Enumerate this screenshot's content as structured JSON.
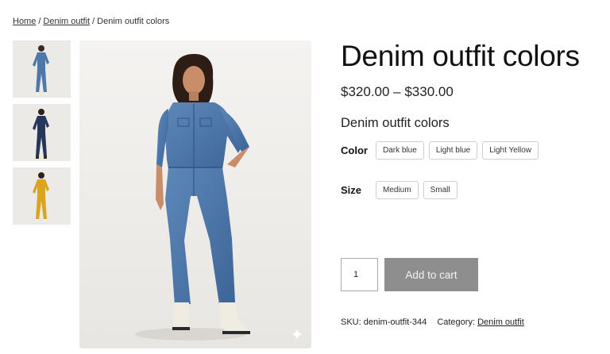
{
  "breadcrumb": {
    "home": "Home",
    "category": "Denim outfit",
    "current": "Denim outfit colors",
    "separator": "/"
  },
  "gallery": {
    "thumbnails": [
      {
        "name": "thumbnail-light-blue",
        "color": "#4f78a8"
      },
      {
        "name": "thumbnail-dark-blue",
        "color": "#25365a"
      },
      {
        "name": "thumbnail-light-yellow",
        "color": "#d9a520"
      }
    ],
    "main_color": "#4d79aa"
  },
  "product": {
    "title": "Denim outfit colors",
    "price": "$320.00 – $330.00",
    "subtitle": "Denim outfit colors",
    "color_label": "Color",
    "colors": [
      "Dark blue",
      "Light blue",
      "Light Yellow"
    ],
    "size_label": "Size",
    "sizes": [
      "Medium",
      "Small"
    ],
    "quantity": "1",
    "add_to_cart": "Add to cart",
    "sku_label": "SKU:",
    "sku": "denim-outfit-344",
    "category_label": "Category:",
    "category": "Denim outfit"
  },
  "colors": {
    "button_bg": "#8e8e8e",
    "button_text": "#f3f3f3",
    "swatch_border": "#cfcfcf"
  },
  "icons": {
    "zoom": "sparkle-icon"
  }
}
